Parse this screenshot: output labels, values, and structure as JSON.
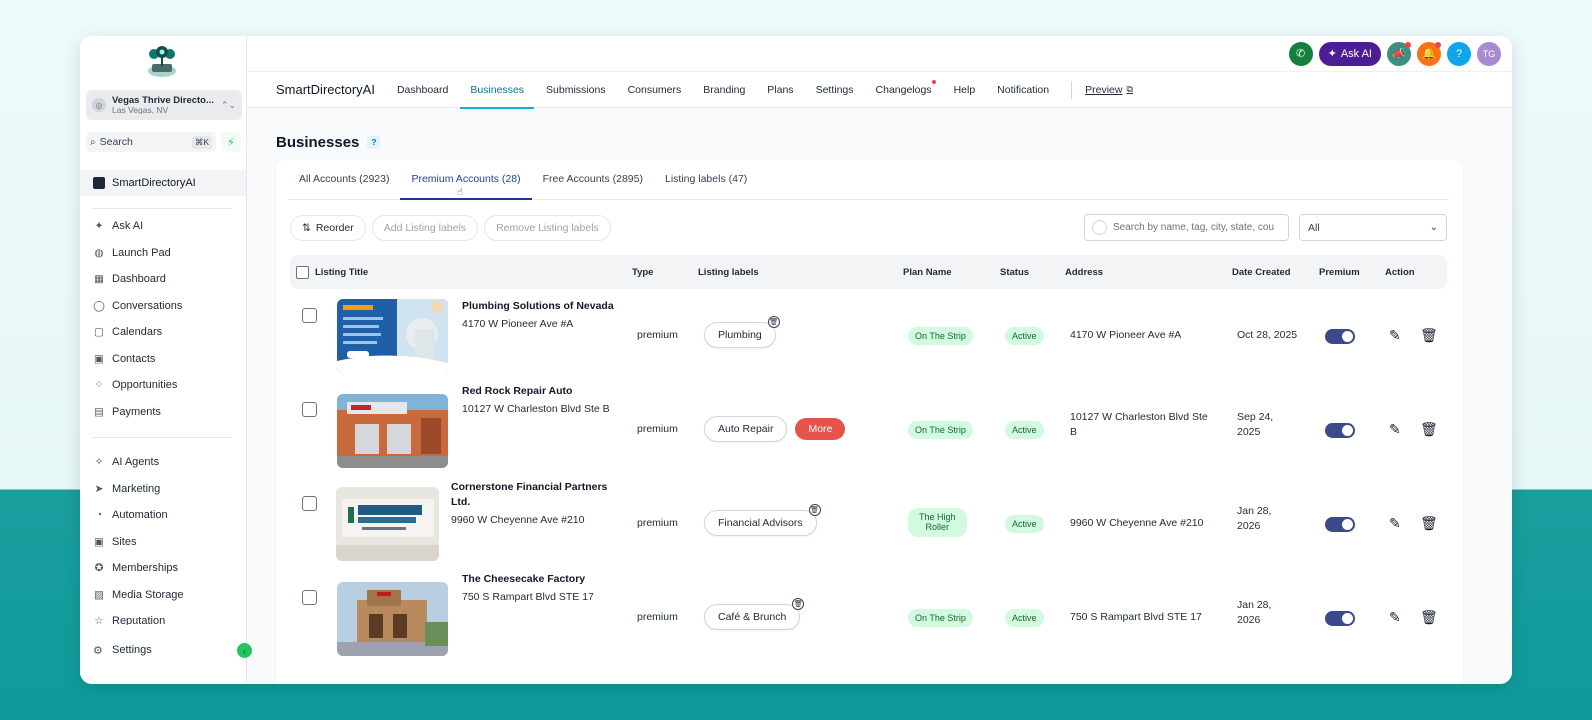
{
  "sidebar": {
    "location_name": "Vegas Thrive Directo...",
    "location_sub": "Las Vegas, NV",
    "search_label": "Search",
    "search_shortcut": "⌘K",
    "app_item": "SmartDirectoryAI",
    "group1": [
      {
        "label": "Ask AI",
        "icon": "sparkle-icon"
      },
      {
        "label": "Launch Pad",
        "icon": "rocket-icon"
      },
      {
        "label": "Dashboard",
        "icon": "grid-icon"
      },
      {
        "label": "Conversations",
        "icon": "chat-icon"
      },
      {
        "label": "Calendars",
        "icon": "calendar-icon"
      },
      {
        "label": "Contacts",
        "icon": "contacts-icon"
      },
      {
        "label": "Opportunities",
        "icon": "opportunities-icon"
      },
      {
        "label": "Payments",
        "icon": "payments-icon"
      }
    ],
    "group2": [
      {
        "label": "AI Agents",
        "icon": "ai-agents-icon"
      },
      {
        "label": "Marketing",
        "icon": "send-icon"
      },
      {
        "label": "Automation",
        "icon": "automation-icon"
      },
      {
        "label": "Sites",
        "icon": "sites-icon"
      },
      {
        "label": "Memberships",
        "icon": "badge-icon"
      },
      {
        "label": "Media Storage",
        "icon": "image-icon"
      },
      {
        "label": "Reputation",
        "icon": "star-icon"
      }
    ],
    "settings": "Settings"
  },
  "topbar": {
    "ask_ai": "Ask AI",
    "avatar": "TG",
    "help": "?"
  },
  "navbar": {
    "brand": "SmartDirectoryAI",
    "tabs": [
      "Dashboard",
      "Businesses",
      "Submissions",
      "Consumers",
      "Branding",
      "Plans",
      "Settings",
      "Changelogs",
      "Help",
      "Notification"
    ],
    "preview": "Preview"
  },
  "page": {
    "title": "Businesses",
    "help": "?"
  },
  "tabs": [
    "All Accounts (2923)",
    "Premium Accounts (28)",
    "Free Accounts (2895)",
    "Listing labels (47)"
  ],
  "toolbar": {
    "reorder": "Reorder",
    "add_labels": "Add Listing labels",
    "remove_labels": "Remove Listing labels",
    "search_placeholder": "Search by name, tag, city, state, cou",
    "filter_value": "All"
  },
  "columns": [
    "Listing Title",
    "Type",
    "Listing labels",
    "Plan Name",
    "Status",
    "Address",
    "Date Created",
    "Premium",
    "Action"
  ],
  "rows": [
    {
      "title": "Plumbing Solutions of Nevada",
      "title2": "",
      "address_line": "4170 W Pioneer Ave #A",
      "type": "premium",
      "label": "Plumbing",
      "more": "",
      "plan": "On The Strip",
      "plan2": "",
      "status": "Active",
      "address": "4170 W Pioneer Ave #A",
      "address2": "",
      "date": "Oct 28, 2025",
      "date2": ""
    },
    {
      "title": "Red Rock Repair Auto",
      "title2": "",
      "address_line": "10127 W Charleston Blvd Ste B",
      "type": "premium",
      "label": "Auto Repair",
      "more": "More",
      "plan": "On The Strip",
      "plan2": "",
      "status": "Active",
      "address": "10127 W Charleston Blvd Ste",
      "address2": "B",
      "date": "Sep 24,",
      "date2": "2025"
    },
    {
      "title": "Cornerstone Financial Partners",
      "title2": "Ltd.",
      "address_line": "9960 W Cheyenne Ave #210",
      "type": "premium",
      "label": "Financial Advisors",
      "more": "",
      "plan": "The High",
      "plan2": "Roller",
      "status": "Active",
      "address": "9960 W Cheyenne Ave #210",
      "address2": "",
      "date": "Jan 28,",
      "date2": "2026"
    },
    {
      "title": "The Cheesecake Factory",
      "title2": "",
      "address_line": "750 S Rampart Blvd STE 17",
      "type": "premium",
      "label": "Café & Brunch",
      "more": "",
      "plan": "On The Strip",
      "plan2": "",
      "status": "Active",
      "address": "750 S Rampart Blvd STE 17",
      "address2": "",
      "date": "Jan 28,",
      "date2": "2026"
    }
  ]
}
